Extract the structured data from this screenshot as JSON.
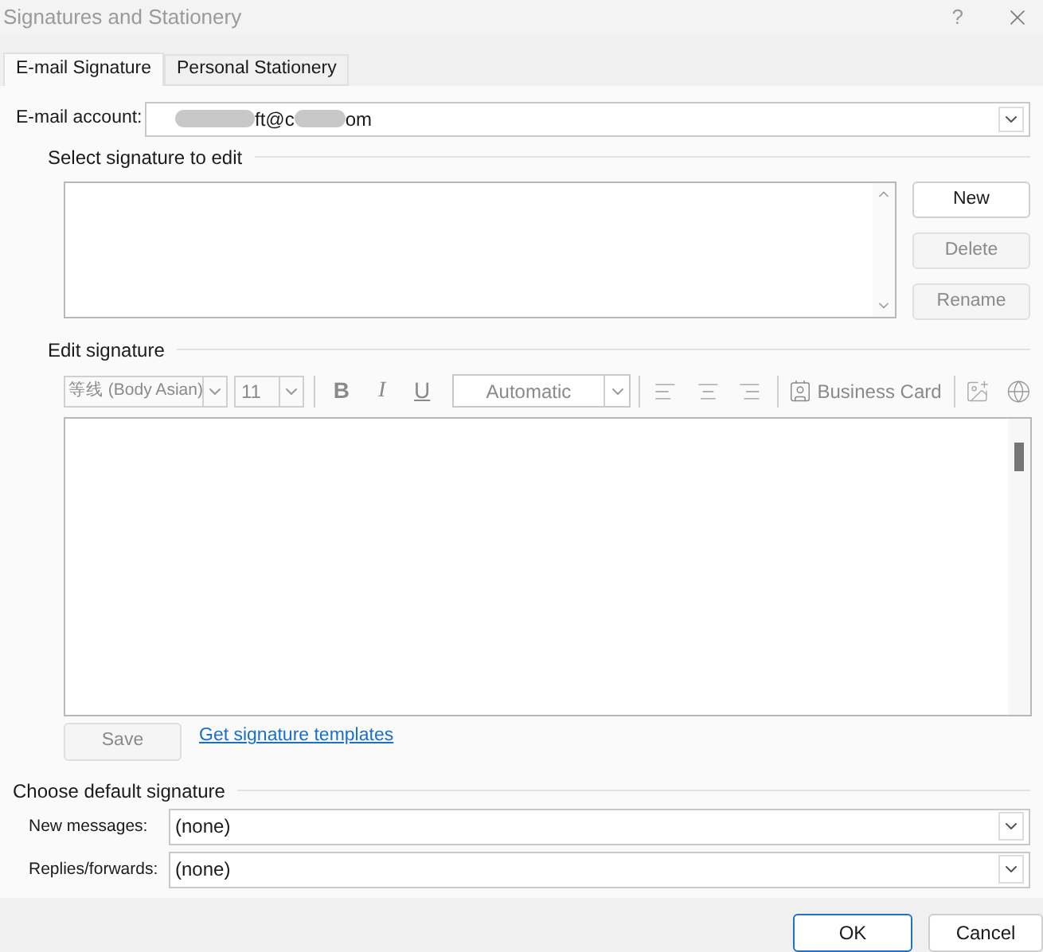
{
  "window": {
    "title": "Signatures and Stationery",
    "help": "?"
  },
  "tabs": [
    {
      "label": "E-mail Signature",
      "selected": true
    },
    {
      "label": "Personal Stationery",
      "selected": false
    }
  ],
  "email_account": {
    "label": "E-mail account:",
    "value_parts": [
      "ft@c",
      "om"
    ]
  },
  "select_signature": {
    "heading": "Select signature to edit",
    "buttons": [
      {
        "label": "New",
        "disabled": false
      },
      {
        "label": "Delete",
        "disabled": true
      },
      {
        "label": "Rename",
        "disabled": true
      }
    ]
  },
  "edit_signature": {
    "heading": "Edit signature",
    "toolbar": {
      "font": "等线 (Body Asian)",
      "size": "11",
      "bold": "B",
      "italic": "I",
      "underline": "U",
      "color_menu": "Automatic",
      "business_card": "Business Card",
      "disabled": true
    },
    "save": {
      "label": "Save",
      "disabled": true
    },
    "link": "Get signature templates"
  },
  "default_signature": {
    "heading": "Choose default signature",
    "rows": [
      {
        "label": "New messages:",
        "value": "(none)"
      },
      {
        "label": "Replies/forwards:",
        "value": "(none)"
      }
    ]
  },
  "footer": {
    "buttons": [
      {
        "label": "OK",
        "kind": "primary"
      },
      {
        "label": "Cancel",
        "kind": "secondary"
      }
    ]
  }
}
